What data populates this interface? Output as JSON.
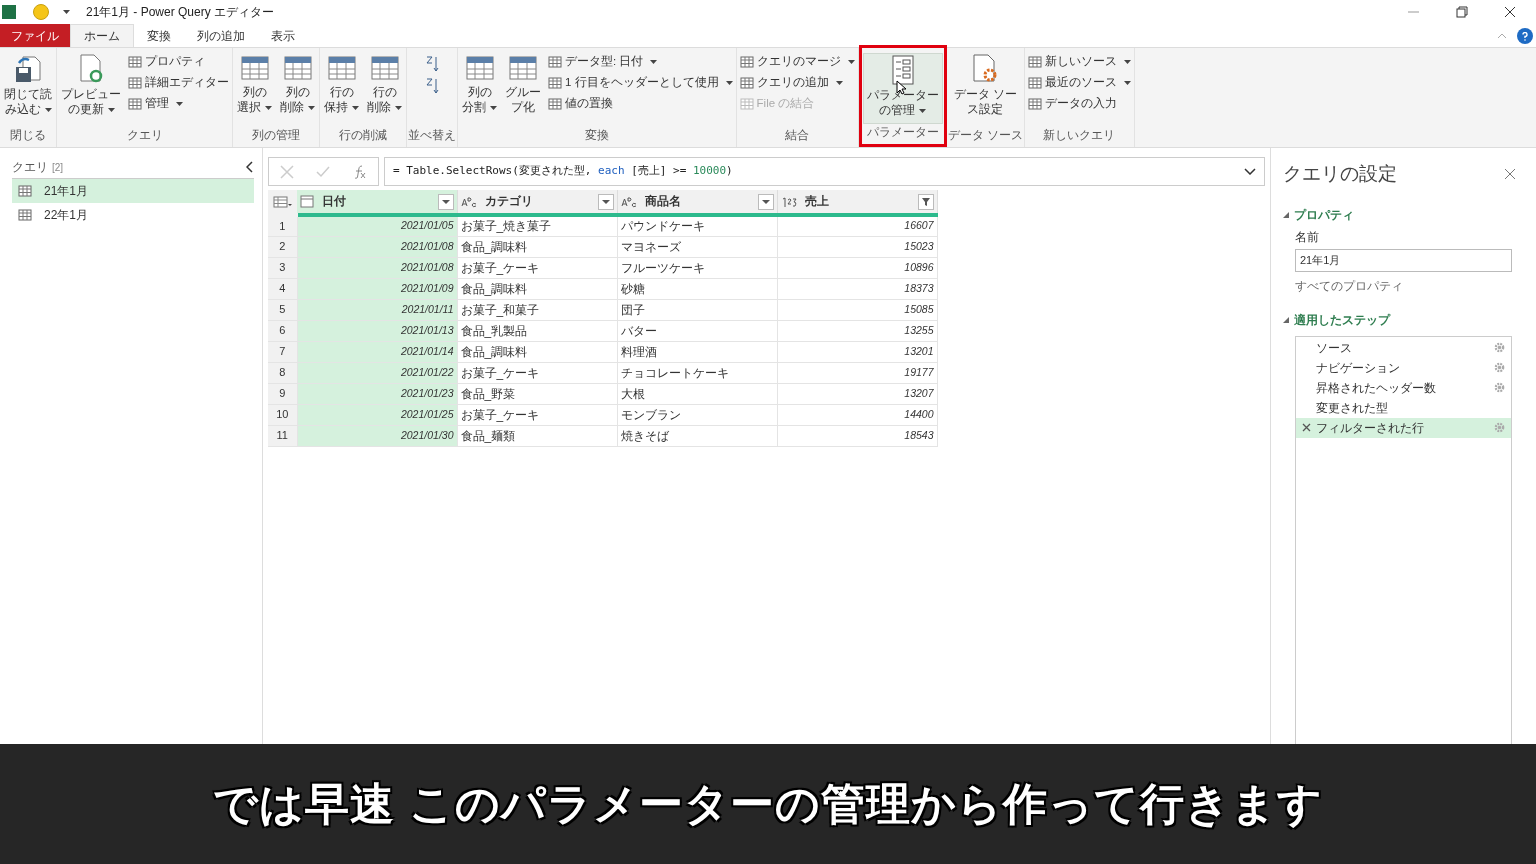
{
  "window": {
    "title": "21年1月 - Power Query エディター"
  },
  "tabs": [
    {
      "label": "ファイル",
      "kind": "file"
    },
    {
      "label": "ホーム",
      "kind": "tab",
      "selected": true
    },
    {
      "label": "変換",
      "kind": "tab",
      "selected": false
    },
    {
      "label": "列の追加",
      "kind": "tab",
      "selected": false
    },
    {
      "label": "表示",
      "kind": "tab",
      "selected": false
    }
  ],
  "ribbon": [
    {
      "label": "閉じる",
      "highlighted": false,
      "items": [
        {
          "kind": "large",
          "lines": [
            "閉じて読",
            "み込む"
          ],
          "dropdown": true
        }
      ]
    },
    {
      "label": "クエリ",
      "highlighted": false,
      "items": [
        {
          "kind": "large",
          "lines": [
            "プレビュー",
            "の更新"
          ],
          "dropdown": true
        },
        {
          "kind": "stack",
          "items": [
            {
              "label": "プロパティ",
              "dropdown": false,
              "disabled": false
            },
            {
              "label": "詳細エディター",
              "dropdown": false,
              "disabled": false
            },
            {
              "label": "管理",
              "dropdown": true,
              "disabled": false
            }
          ]
        }
      ]
    },
    {
      "label": "列の管理",
      "highlighted": false,
      "items": [
        {
          "kind": "large",
          "lines": [
            "列の",
            "選択"
          ],
          "dropdown": true
        },
        {
          "kind": "large",
          "lines": [
            "列の",
            "削除"
          ],
          "dropdown": true
        }
      ]
    },
    {
      "label": "行の削減",
      "highlighted": false,
      "items": [
        {
          "kind": "large",
          "lines": [
            "行の",
            "保持"
          ],
          "dropdown": true
        },
        {
          "kind": "large",
          "lines": [
            "行の",
            "削除"
          ],
          "dropdown": true
        }
      ]
    },
    {
      "label": "並べ替え",
      "highlighted": false,
      "items": [
        {
          "kind": "sort"
        }
      ]
    },
    {
      "label": "変換",
      "highlighted": false,
      "items": [
        {
          "kind": "large",
          "lines": [
            "列の",
            "分割"
          ],
          "dropdown": true
        },
        {
          "kind": "large",
          "lines": [
            "グルー",
            "プ化"
          ],
          "dropdown": false
        },
        {
          "kind": "stack",
          "items": [
            {
              "label": "データ型: 日付",
              "dropdown": true,
              "disabled": false
            },
            {
              "label": "1 行目をヘッダーとして使用",
              "dropdown": true,
              "disabled": false
            },
            {
              "label": "値の置換",
              "dropdown": false,
              "disabled": false
            }
          ]
        }
      ]
    },
    {
      "label": "結合",
      "highlighted": false,
      "items": [
        {
          "kind": "stack",
          "items": [
            {
              "label": "クエリのマージ",
              "dropdown": true,
              "disabled": false
            },
            {
              "label": "クエリの追加",
              "dropdown": true,
              "disabled": false
            },
            {
              "label": "File の結合",
              "dropdown": false,
              "disabled": true
            }
          ]
        }
      ]
    },
    {
      "label": "パラメーター",
      "highlighted": true,
      "items": [
        {
          "kind": "large",
          "lines": [
            "パラメーター",
            "の管理"
          ],
          "dropdown": true,
          "hovered": true
        }
      ]
    },
    {
      "label": "データ ソース",
      "highlighted": false,
      "items": [
        {
          "kind": "large",
          "lines": [
            "データ ソー",
            "ス設定"
          ],
          "dropdown": false
        }
      ]
    },
    {
      "label": "新しいクエリ",
      "highlighted": false,
      "items": [
        {
          "kind": "stack",
          "items": [
            {
              "label": "新しいソース",
              "dropdown": true,
              "disabled": false
            },
            {
              "label": "最近のソース",
              "dropdown": true,
              "disabled": false
            },
            {
              "label": "データの入力",
              "dropdown": false,
              "disabled": false
            }
          ]
        }
      ]
    }
  ],
  "queries": {
    "title": "クエリ",
    "count": "[2]",
    "items": [
      {
        "name": "21年1月",
        "selected": true
      },
      {
        "name": "22年1月",
        "selected": false
      }
    ]
  },
  "formula_bar": {
    "segments": [
      {
        "kind": "plain",
        "text": "= Table.SelectRows(変更された型, "
      },
      {
        "kind": "keyword",
        "text": "each"
      },
      {
        "kind": "plain",
        "text": " [売上] >= "
      },
      {
        "kind": "number",
        "text": "10000"
      },
      {
        "kind": "plain",
        "text": ")"
      }
    ]
  },
  "table": {
    "columns": [
      {
        "name": "日付",
        "kind": "date",
        "selected": true,
        "filtered": false
      },
      {
        "name": "カテゴリ",
        "kind": "text",
        "selected": false,
        "filtered": false
      },
      {
        "name": "商品名",
        "kind": "text",
        "selected": false,
        "filtered": false
      },
      {
        "name": "売上",
        "kind": "number",
        "selected": false,
        "filtered": true
      }
    ],
    "rows": [
      {
        "number": "1",
        "cells": [
          "2021/01/05",
          "お菓子_焼き菓子",
          "パウンドケーキ",
          "16607"
        ]
      },
      {
        "number": "2",
        "cells": [
          "2021/01/08",
          "食品_調味料",
          "マヨネーズ",
          "15023"
        ]
      },
      {
        "number": "3",
        "cells": [
          "2021/01/08",
          "お菓子_ケーキ",
          "フルーツケーキ",
          "10896"
        ]
      },
      {
        "number": "4",
        "cells": [
          "2021/01/09",
          "食品_調味料",
          "砂糖",
          "18373"
        ]
      },
      {
        "number": "5",
        "cells": [
          "2021/01/11",
          "お菓子_和菓子",
          "団子",
          "15085"
        ]
      },
      {
        "number": "6",
        "cells": [
          "2021/01/13",
          "食品_乳製品",
          "バター",
          "13255"
        ]
      },
      {
        "number": "7",
        "cells": [
          "2021/01/14",
          "食品_調味料",
          "料理酒",
          "13201"
        ]
      },
      {
        "number": "8",
        "cells": [
          "2021/01/22",
          "お菓子_ケーキ",
          "チョコレートケーキ",
          "19177"
        ]
      },
      {
        "number": "9",
        "cells": [
          "2021/01/23",
          "食品_野菜",
          "大根",
          "13207"
        ]
      },
      {
        "number": "10",
        "cells": [
          "2021/01/25",
          "お菓子_ケーキ",
          "モンブラン",
          "14400"
        ]
      },
      {
        "number": "11",
        "cells": [
          "2021/01/30",
          "食品_麺類",
          "焼きそば",
          "18543"
        ]
      }
    ]
  },
  "settings": {
    "title": "クエリの設定",
    "properties": {
      "heading": "プロパティ",
      "expanded": true,
      "name_label": "名前",
      "name_value": "21年1月",
      "link": "すべてのプロパティ"
    },
    "steps": {
      "heading": "適用したステップ",
      "expanded": true,
      "items": [
        {
          "name": "ソース",
          "selected": false,
          "gear": true
        },
        {
          "name": "ナビゲーション",
          "selected": false,
          "gear": true
        },
        {
          "name": "昇格されたヘッダー数",
          "selected": false,
          "gear": true
        },
        {
          "name": "変更された型",
          "selected": false,
          "gear": false
        },
        {
          "name": "フィルターされた行",
          "selected": true,
          "gear": true
        }
      ]
    }
  },
  "subtitle": "では早速 このパラメーターの管理から作って行きます"
}
